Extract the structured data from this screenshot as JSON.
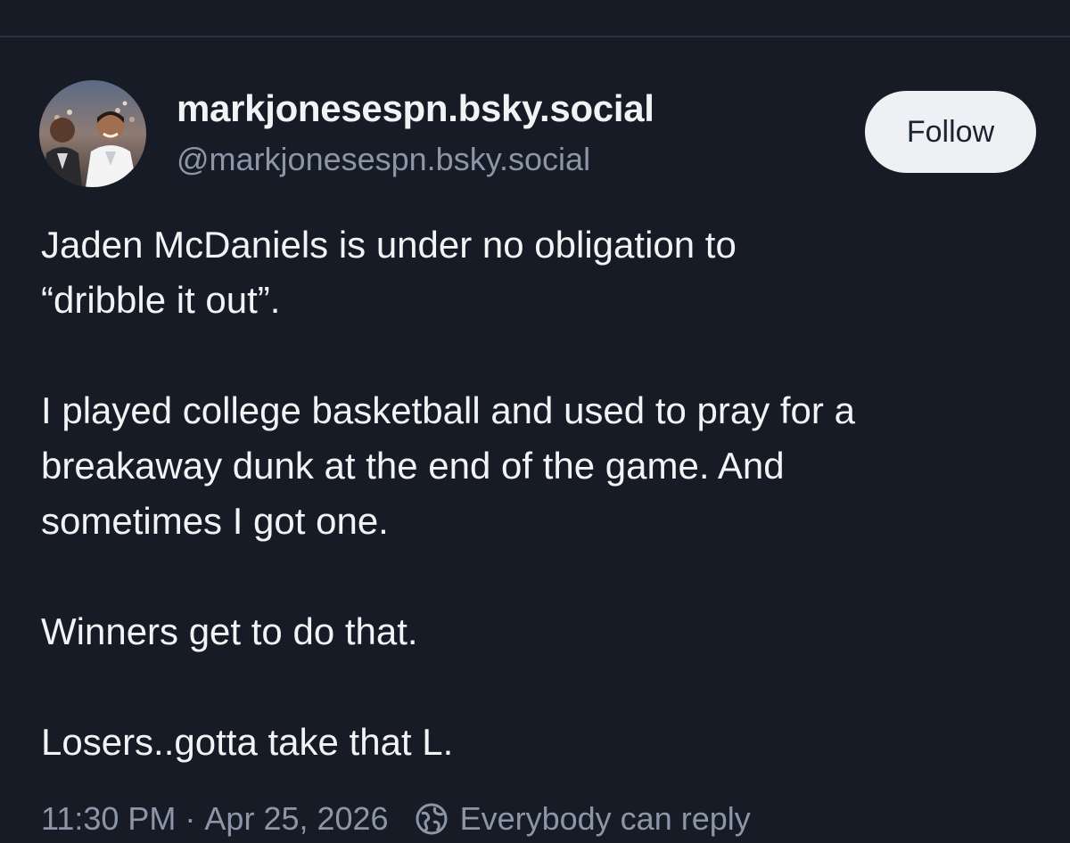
{
  "post": {
    "author": {
      "display_name": "markjonesespn.bsky.social",
      "handle": "@markjonesespn.bsky.social",
      "avatar_icon": "profile-photo"
    },
    "follow_label": "Follow",
    "paragraphs": [
      "Jaden McDaniels is under no obligation to\n“dribble it out”.",
      "I played college basketball and used to pray for a\nbreakaway dunk at the end of the game. And\nsometimes I got one.",
      "Winners get to do that.",
      "Losers..gotta take that L."
    ],
    "timestamp": "11:30 PM",
    "separator": "·",
    "date": "Apr 25, 2026",
    "reply_setting": "Everybody can reply",
    "reply_icon": "globe-icon"
  },
  "colors": {
    "background": "#161b25",
    "text_primary": "#f1f3f5",
    "text_secondary": "#8b97a8",
    "follow_button_bg": "#eef0f3",
    "divider": "#2b323d"
  }
}
